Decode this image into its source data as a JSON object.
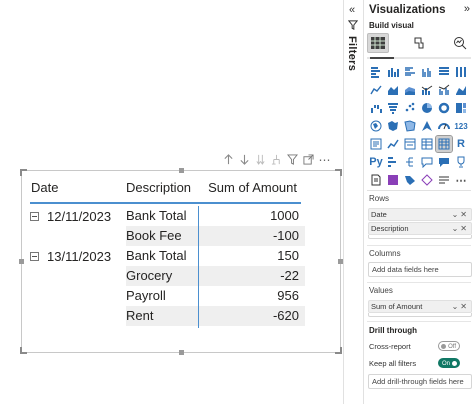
{
  "matrix": {
    "headers": {
      "date": "Date",
      "description": "Description",
      "amount": "Sum of Amount"
    },
    "rows": [
      {
        "date": "12/11/2023",
        "description": "Bank Total",
        "amount": "1000"
      },
      {
        "date": "",
        "description": "Book Fee",
        "amount": "-100"
      },
      {
        "date": "13/11/2023",
        "description": "Bank Total",
        "amount": "150"
      },
      {
        "date": "",
        "description": "Grocery",
        "amount": "-22"
      },
      {
        "date": "",
        "description": "Payroll",
        "amount": "956"
      },
      {
        "date": "",
        "description": "Rent",
        "amount": "-620"
      }
    ],
    "accent_color": "#4b8fcf"
  },
  "visual_header": {
    "icons": [
      "arrow-up-icon",
      "arrow-down-icon",
      "double-arrow-down-icon",
      "expand-hierarchy-icon",
      "filter-icon",
      "focus-mode-icon",
      "more-options-icon"
    ]
  },
  "filters_pane": {
    "label": "Filters",
    "collapse_glyph": "«"
  },
  "viz_pane": {
    "title": "Visualizations",
    "expand_glyph": "»",
    "build_label": "Build visual",
    "r_label": "R",
    "py_label": "Py",
    "rows_label": "Rows",
    "rows_fields": [
      "Date",
      "Description"
    ],
    "columns_label": "Columns",
    "columns_placeholder": "Add data fields here",
    "values_label": "Values",
    "values_fields": [
      "Sum of Amount"
    ],
    "drill_title": "Drill through",
    "cross_report_label": "Cross-report",
    "cross_report_state": "Off",
    "keep_filters_label": "Keep all filters",
    "keep_filters_state": "On",
    "drill_placeholder": "Add drill-through fields here",
    "toggle_on_color": "#117865"
  }
}
